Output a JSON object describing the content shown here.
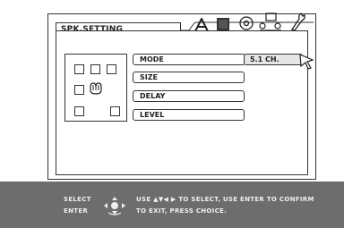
{
  "header": {
    "title": "SPK.SETTING",
    "tab_icons": [
      "a-letter-icon",
      "speaker-icon",
      "disc-icon",
      "scene-icon",
      "wrench-icon"
    ]
  },
  "menu": {
    "items": [
      {
        "label": "MODE",
        "selected": true
      },
      {
        "label": "SIZE",
        "selected": false
      },
      {
        "label": "DELAY",
        "selected": false
      },
      {
        "label": "LEVEL",
        "selected": false
      }
    ],
    "current_value": "5.1 CH."
  },
  "footer": {
    "select_label": "SELECT",
    "enter_label": "ENTER",
    "line1": "USE ▲▼◀ ▶ TO SELECT, USE ENTER TO CONFIRM",
    "line2": "TO EXIT, PRESS CHOICE."
  },
  "colors": {
    "footer_bg": "#6d6d6d",
    "value_bg": "#e6e6e6",
    "outline": "#333333"
  }
}
